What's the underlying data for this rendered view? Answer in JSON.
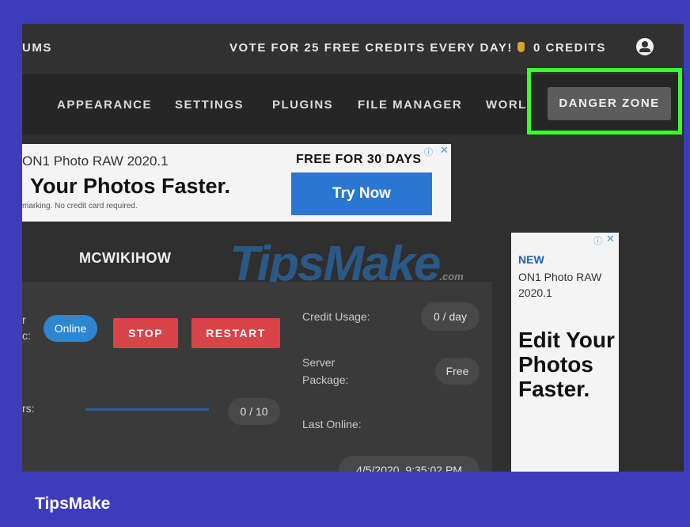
{
  "topbar": {
    "partial_left": "UMS",
    "vote_text": "VOTE FOR 25 FREE CREDITS EVERY DAY!",
    "credits": "0 CREDITS",
    "user_icon": "user-circle-icon"
  },
  "nav": {
    "items": [
      "APPEARANCE",
      "SETTINGS",
      "PLUGINS",
      "FILE MANAGER",
      "WORL"
    ],
    "danger": "DANGER ZONE",
    "highlight_color": "#3dfc2c"
  },
  "ad_top": {
    "product": "ON1 Photo RAW 2020.1",
    "headline": "Your Photos Faster.",
    "fineprint": "marking. No credit card required.",
    "offer": "FREE FOR 30 DAYS",
    "cta": "Try Now"
  },
  "server": {
    "name": "MCWIKIHOW",
    "status": "Online",
    "stop": "STOP",
    "restart": "RESTART",
    "players_value": "0 / 10",
    "credit_usage_label": "Credit Usage:",
    "credit_usage_value": "0 / day",
    "package_label_1": "Server",
    "package_label_2": "Package:",
    "package_value": "Free",
    "last_online_label": "Last Online:",
    "last_online_value": "4/5/2020, 9:35:02 PM",
    "partial_label_a": "r",
    "partial_label_b": "c:",
    "partial_label_c": "rs:"
  },
  "ad_right": {
    "new": "NEW",
    "product": "ON1 Photo RAW 2020.1",
    "headline": "Edit Your Photos Faster."
  },
  "watermark": {
    "main": "TipsMake",
    "suffix": ".com"
  },
  "footer": {
    "brand": "TipsMake"
  },
  "colors": {
    "background": "#3d3dbc",
    "online": "#2d86cf",
    "stop": "#d9434a",
    "cta": "#2b76d2"
  }
}
